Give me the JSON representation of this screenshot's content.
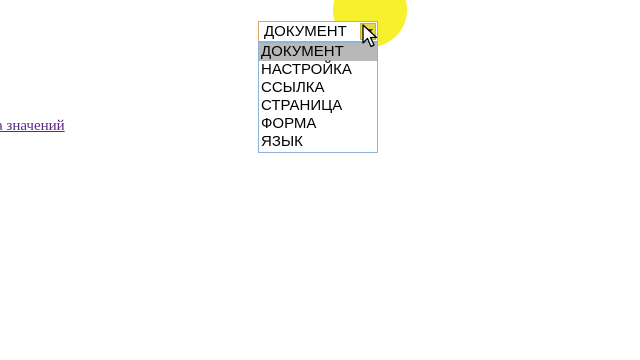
{
  "page": {
    "partial_link_text": "а значений"
  },
  "select": {
    "current_value": "ДОКУМЕНТ",
    "arrow_icon": "dropdown-arrow-icon",
    "options": [
      {
        "label": "ДОКУМЕНТ",
        "selected": true
      },
      {
        "label": "НАСТРОЙКА",
        "selected": false
      },
      {
        "label": "ССЫЛКА",
        "selected": false
      },
      {
        "label": "СТРАНИЦА",
        "selected": false
      },
      {
        "label": "ФОРМА",
        "selected": false
      },
      {
        "label": "ЯЗЫК",
        "selected": false
      }
    ]
  },
  "overlay": {
    "cursor_icon": "mouse-pointer-icon",
    "highlight_color": "#f6ee10"
  }
}
